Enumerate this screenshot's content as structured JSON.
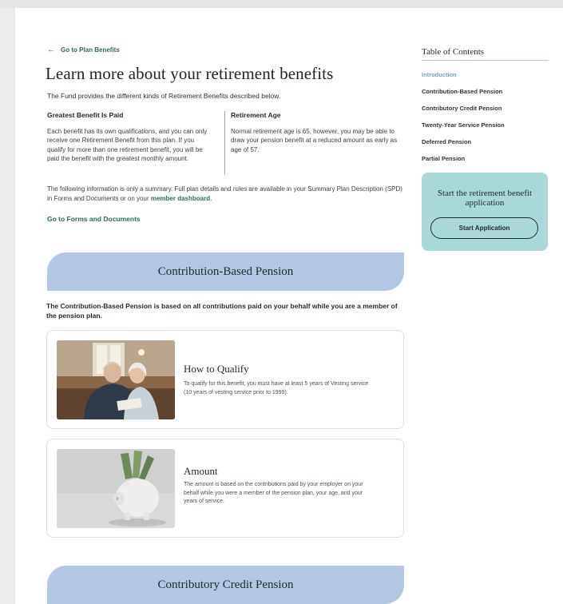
{
  "nav": {
    "back_arrow": "←",
    "back_label": "Go to Plan Benefits"
  },
  "header": {
    "title": "Learn more about your retirement benefits",
    "intro": "The Fund provides the different kinds of Retirement Benefits described below."
  },
  "columns": {
    "left": {
      "heading": "Greatest Benefit Is Paid",
      "text": "Each benefit has its own qualifications, and you can only receive one Retirement Benefit from this plan. If you qualify for more than one retirement benefit, you will be paid the benefit with the greatest monthly amount."
    },
    "right": {
      "heading": "Retirement Age",
      "text": "Normal retirement age is 65, however, you may be able to draw your pension benefit at a reduced amount as early as age of 57."
    }
  },
  "summary": {
    "text": "The following information is only a summary. Full plan details and rules are available in your Summary Plan Description (SPD) in Forms and Documents or on your ",
    "link": "member dashboard",
    "end": "."
  },
  "forms_link": "Go to Forms and Documents",
  "sections": [
    {
      "title": "Contribution-Based Pension",
      "description": "The Contribution-Based Pension is based on all contributions paid on your behalf while you are a member of the pension plan.",
      "cards": [
        {
          "title": "How to Qualify",
          "text": "To qualify for this benefit, you must have at least 5 years of Vesting service (10 years of vesting service prior to 1999)."
        },
        {
          "title": "Amount",
          "text": "The amount is based on the contributions paid by your employer on your behalf while you were a member of the pension plan, your age, and your years of service."
        }
      ]
    },
    {
      "title": "Contributory Credit Pension"
    }
  ],
  "toc": {
    "title": "Table of Contents",
    "items": [
      {
        "label": "Introduction",
        "active": true
      },
      {
        "label": "Contribution-Based Pension"
      },
      {
        "label": "Contributory Credit Pension"
      },
      {
        "label": "Twenty-Year Service Pension"
      },
      {
        "label": "Deferred Pension"
      },
      {
        "label": "Partial Pension"
      }
    ]
  },
  "cta": {
    "text": "Start the retirement benefit application",
    "button": "Start Application"
  },
  "colors": {
    "accent_green": "#2c6b62",
    "banner_blue": "#b3c7e3",
    "cta_teal": "#a9d8d8",
    "toc_active": "#7ba5b8"
  }
}
